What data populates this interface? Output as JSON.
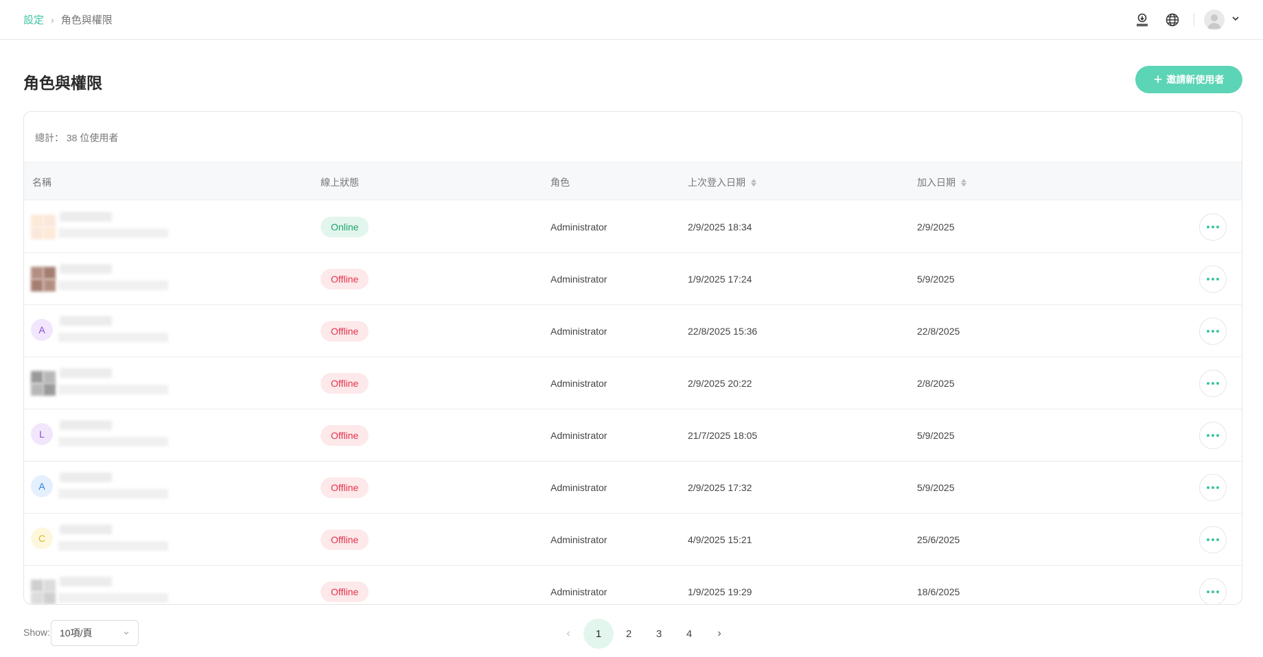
{
  "breadcrumb": {
    "parent": "設定",
    "separator": "›",
    "current": "角色與權限"
  },
  "page": {
    "title": "角色與權限",
    "invite_label": "邀請新使用者"
  },
  "summary": {
    "total_label": "總計： 38 位使用者"
  },
  "table": {
    "headers": {
      "name": "名稱",
      "status": "線上狀態",
      "role": "角色",
      "last_login": "上次登入日期",
      "joined": "加入日期"
    },
    "rows": [
      {
        "avatar": "",
        "status": "Online",
        "role": "Administrator",
        "last_login": "2/9/2025 18:34",
        "joined": "2/9/2025"
      },
      {
        "avatar": "",
        "status": "Offline",
        "role": "Administrator",
        "last_login": "1/9/2025 17:24",
        "joined": "5/9/2025"
      },
      {
        "avatar": "A",
        "status": "Offline",
        "role": "Administrator",
        "last_login": "22/8/2025 15:36",
        "joined": "22/8/2025"
      },
      {
        "avatar": "",
        "status": "Offline",
        "role": "Administrator",
        "last_login": "2/9/2025 20:22",
        "joined": "2/8/2025"
      },
      {
        "avatar": "L",
        "status": "Offline",
        "role": "Administrator",
        "last_login": "21/7/2025 18:05",
        "joined": "5/9/2025"
      },
      {
        "avatar": "A",
        "status": "Offline",
        "role": "Administrator",
        "last_login": "2/9/2025 17:32",
        "joined": "5/9/2025"
      },
      {
        "avatar": "C",
        "status": "Offline",
        "role": "Administrator",
        "last_login": "4/9/2025 15:21",
        "joined": "25/6/2025"
      },
      {
        "avatar": "",
        "status": "Offline",
        "role": "Administrator",
        "last_login": "1/9/2025 19:29",
        "joined": "18/6/2025"
      }
    ]
  },
  "footer": {
    "show_label": "Show:",
    "page_size": "10項/頁",
    "pages": [
      "1",
      "2",
      "3",
      "4"
    ],
    "current_page": "1"
  },
  "colors": {
    "accent": "#5cd4b6",
    "online_bg": "#e3f6ee",
    "online_text": "#1ea36a",
    "offline_bg": "#fde8ea",
    "offline_text": "#e0344b"
  },
  "icons": {
    "header": [
      "download-icon",
      "globe-icon",
      "user-avatar-icon",
      "chevron-down-icon"
    ],
    "row_action": "more-horizontal-icon"
  }
}
